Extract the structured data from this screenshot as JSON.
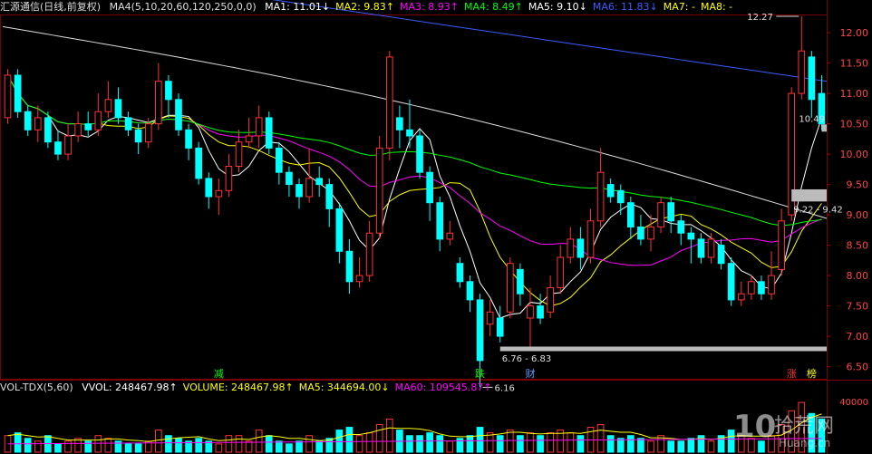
{
  "header": {
    "title": "汇源通信(日线,前复权)",
    "ma_spec": "MA4(5,10,20,60,120,250,0,0)",
    "items": [
      {
        "text": "MA1: 11.01↓",
        "color": "#ffffff"
      },
      {
        "text": "MA2: 9.83↑",
        "color": "#ffff00"
      },
      {
        "text": "MA3: 8.93↑",
        "color": "#ff00ff"
      },
      {
        "text": "MA4: 8.49↑",
        "color": "#00ff00"
      },
      {
        "text": "MA5: 9.10↓",
        "color": "#ffffff"
      },
      {
        "text": "MA6: 11.83↓",
        "color": "#3a5cff"
      },
      {
        "text": "MA7: -",
        "color": "#ffff00"
      },
      {
        "text": "MA8: -",
        "color": "#ffff00"
      }
    ]
  },
  "volume_header": {
    "spec": "VOL-TDX(5,60)",
    "items": [
      {
        "text": "VVOL: 248467.98↑",
        "color": "#ffffff"
      },
      {
        "text": "VOLUME: 248467.98↑",
        "color": "#ffff00"
      },
      {
        "text": "MA5: 344694.00↓",
        "color": "#ffff00"
      },
      {
        "text": "MA60: 109545.87↑",
        "color": "#ff00ff"
      }
    ]
  },
  "chart_data": [
    {
      "type": "candlestick",
      "ylim": [
        6.3,
        12.3
      ],
      "y_ticks": [
        "6.50",
        "7.00",
        "7.50",
        "8.00",
        "8.50",
        "9.00",
        "9.50",
        "10.00",
        "10.50",
        "11.00",
        "11.50",
        "12.00"
      ],
      "annotations": {
        "high": "12.27",
        "low": "6.16",
        "zone_low": "6.76 - 6.83",
        "zone_mid": "9.22 - 9.42",
        "zone_top": "10.49"
      },
      "events": [
        {
          "label": "减",
          "color": "#00ff00",
          "index": 21
        },
        {
          "label": "跌",
          "color": "#00ff00",
          "index": 47
        },
        {
          "label": "财",
          "color": "#6699ff",
          "index": 52
        },
        {
          "label": "涨",
          "color": "#ff3333",
          "index": 78
        },
        {
          "label": "榜",
          "color": "#ffff00",
          "index": 80
        }
      ],
      "candles": [
        [
          10.6,
          11.3,
          11.4,
          10.5
        ],
        [
          11.3,
          10.7,
          11.4,
          10.6
        ],
        [
          10.7,
          10.4,
          10.8,
          10.3
        ],
        [
          10.4,
          10.6,
          10.8,
          10.2
        ],
        [
          10.6,
          10.2,
          10.7,
          10.1
        ],
        [
          10.2,
          10.0,
          10.4,
          9.9
        ],
        [
          10.0,
          10.3,
          10.5,
          9.9
        ],
        [
          10.3,
          10.5,
          10.7,
          10.2
        ],
        [
          10.5,
          10.4,
          10.7,
          10.3
        ],
        [
          10.4,
          10.7,
          11.0,
          10.3
        ],
        [
          10.7,
          10.9,
          11.2,
          10.6
        ],
        [
          10.9,
          10.6,
          11.1,
          10.5
        ],
        [
          10.6,
          10.4,
          10.7,
          10.3
        ],
        [
          10.4,
          10.2,
          10.5,
          10.0
        ],
        [
          10.2,
          10.5,
          10.6,
          10.1
        ],
        [
          10.5,
          11.2,
          11.5,
          10.4
        ],
        [
          11.2,
          10.9,
          11.3,
          10.6
        ],
        [
          10.9,
          10.4,
          11.0,
          10.3
        ],
        [
          10.4,
          10.1,
          10.5,
          9.9
        ],
        [
          10.1,
          9.6,
          10.2,
          9.5
        ],
        [
          9.6,
          9.3,
          9.7,
          9.1
        ],
        [
          9.3,
          9.4,
          9.6,
          9.0
        ],
        [
          9.4,
          9.8,
          10.0,
          9.3
        ],
        [
          9.8,
          10.2,
          10.4,
          9.7
        ],
        [
          10.2,
          10.3,
          10.6,
          10.1
        ],
        [
          10.3,
          10.6,
          10.8,
          10.1
        ],
        [
          10.6,
          10.1,
          10.7,
          10.0
        ],
        [
          10.1,
          9.7,
          10.2,
          9.5
        ],
        [
          9.7,
          9.5,
          9.8,
          9.3
        ],
        [
          9.5,
          9.3,
          9.6,
          9.1
        ],
        [
          9.3,
          9.6,
          10.1,
          9.2
        ],
        [
          9.6,
          9.5,
          9.8,
          9.3
        ],
        [
          9.5,
          9.1,
          9.6,
          8.8
        ],
        [
          9.1,
          8.4,
          9.2,
          8.2
        ],
        [
          8.4,
          7.9,
          8.6,
          7.7
        ],
        [
          7.9,
          8.0,
          8.3,
          7.8
        ],
        [
          8.0,
          8.7,
          8.9,
          7.9
        ],
        [
          8.7,
          10.1,
          10.3,
          8.6
        ],
        [
          10.1,
          11.6,
          11.7,
          9.9
        ],
        [
          10.6,
          10.4,
          10.8,
          10.1
        ],
        [
          10.4,
          10.3,
          10.9,
          10.1
        ],
        [
          10.3,
          9.7,
          10.4,
          9.6
        ],
        [
          9.7,
          9.2,
          9.8,
          8.9
        ],
        [
          9.2,
          8.6,
          9.3,
          8.4
        ],
        [
          8.6,
          8.7,
          8.9,
          8.5
        ],
        [
          8.2,
          7.9,
          8.3,
          7.8
        ],
        [
          7.9,
          7.6,
          8.0,
          7.4
        ],
        [
          7.6,
          6.6,
          7.7,
          6.16
        ],
        [
          7.2,
          7.4,
          7.6,
          7.0
        ],
        [
          7.3,
          7.0,
          7.5,
          6.9
        ],
        [
          7.4,
          8.2,
          8.3,
          7.3
        ],
        [
          8.1,
          7.7,
          8.2,
          7.5
        ],
        [
          7.3,
          7.5,
          7.8,
          6.8
        ],
        [
          7.5,
          7.3,
          7.7,
          7.2
        ],
        [
          7.4,
          7.8,
          8.0,
          7.3
        ],
        [
          7.8,
          8.3,
          8.5,
          7.7
        ],
        [
          8.3,
          8.6,
          8.8,
          8.2
        ],
        [
          8.6,
          8.3,
          8.8,
          8.1
        ],
        [
          8.3,
          8.9,
          9.1,
          8.2
        ],
        [
          8.9,
          9.7,
          10.1,
          8.8
        ],
        [
          9.5,
          9.3,
          9.6,
          9.2
        ],
        [
          9.4,
          9.2,
          9.5,
          9.0
        ],
        [
          9.2,
          8.8,
          9.3,
          8.6
        ],
        [
          8.8,
          8.6,
          9.0,
          8.5
        ],
        [
          8.6,
          8.8,
          9.0,
          8.4
        ],
        [
          8.8,
          9.2,
          9.3,
          8.7
        ],
        [
          9.2,
          8.9,
          9.3,
          8.7
        ],
        [
          8.9,
          8.7,
          9.0,
          8.5
        ],
        [
          8.7,
          8.6,
          8.8,
          8.2
        ],
        [
          8.6,
          8.3,
          8.7,
          8.2
        ],
        [
          8.3,
          8.6,
          8.7,
          8.2
        ],
        [
          8.5,
          8.2,
          8.6,
          8.1
        ],
        [
          8.2,
          7.6,
          8.3,
          7.5
        ],
        [
          7.6,
          7.7,
          7.9,
          7.5
        ],
        [
          7.7,
          7.9,
          8.0,
          7.6
        ],
        [
          7.9,
          7.7,
          8.0,
          7.6
        ],
        [
          7.7,
          8.0,
          8.4,
          7.6
        ],
        [
          8.1,
          8.9,
          9.1,
          8.0
        ],
        [
          9.0,
          11.0,
          11.1,
          8.9
        ],
        [
          11.0,
          11.7,
          12.27,
          10.9
        ],
        [
          11.6,
          10.9,
          11.7,
          10.6
        ],
        [
          11.0,
          10.5,
          11.3,
          10.4
        ]
      ]
    },
    {
      "type": "bar",
      "title": "volume",
      "axis_label": "40000",
      "note": "relative volume levels per candle (0-1)",
      "values": [
        0.3,
        0.35,
        0.25,
        0.2,
        0.3,
        0.15,
        0.2,
        0.25,
        0.2,
        0.3,
        0.25,
        0.2,
        0.15,
        0.15,
        0.2,
        0.4,
        0.3,
        0.25,
        0.2,
        0.25,
        0.2,
        0.15,
        0.3,
        0.3,
        0.2,
        0.4,
        0.3,
        0.2,
        0.15,
        0.2,
        0.3,
        0.2,
        0.25,
        0.4,
        0.45,
        0.3,
        0.35,
        0.5,
        0.6,
        0.4,
        0.3,
        0.3,
        0.35,
        0.3,
        0.2,
        0.25,
        0.3,
        0.45,
        0.35,
        0.3,
        0.4,
        0.3,
        0.35,
        0.3,
        0.35,
        0.4,
        0.35,
        0.3,
        0.45,
        0.5,
        0.3,
        0.25,
        0.3,
        0.25,
        0.2,
        0.3,
        0.2,
        0.2,
        0.25,
        0.3,
        0.2,
        0.3,
        0.4,
        0.3,
        0.25,
        0.2,
        0.3,
        0.5,
        0.75,
        0.9,
        0.7,
        0.6
      ]
    }
  ],
  "watermark": {
    "text1": "10",
    "text2": "拾荒网",
    "text3": "Huang.cn"
  }
}
